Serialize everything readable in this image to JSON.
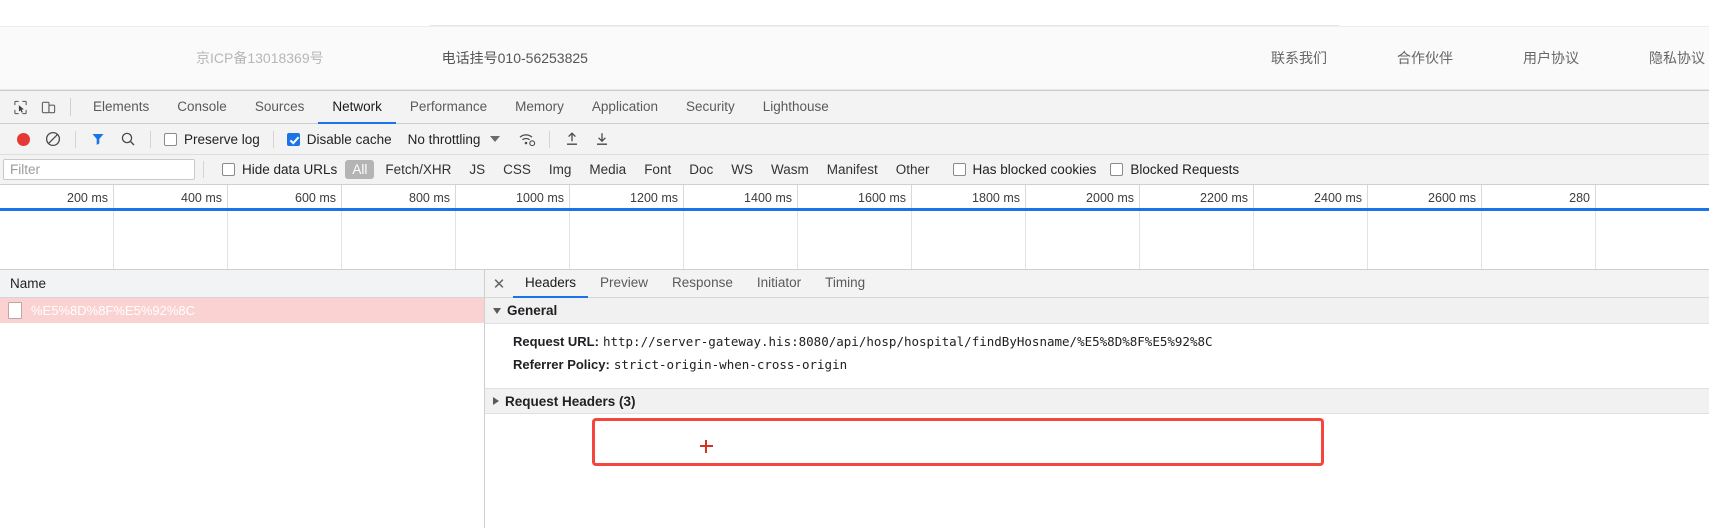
{
  "site": {
    "icp": "京ICP备13018369号",
    "tel": "电话挂号010-56253825",
    "links": [
      "联系我们",
      "合作伙伴",
      "用户协议",
      "隐私协议"
    ]
  },
  "devtools": {
    "inspect_icon": "inspect-element-icon",
    "device_icon": "device-toolbar-icon",
    "tabs": [
      {
        "label": "Elements",
        "active": false
      },
      {
        "label": "Console",
        "active": false
      },
      {
        "label": "Sources",
        "active": false
      },
      {
        "label": "Network",
        "active": true
      },
      {
        "label": "Performance",
        "active": false
      },
      {
        "label": "Memory",
        "active": false
      },
      {
        "label": "Application",
        "active": false
      },
      {
        "label": "Security",
        "active": false
      },
      {
        "label": "Lighthouse",
        "active": false
      }
    ],
    "toolbar": {
      "record_icon": "record-stop-icon",
      "clear_icon": "clear-icon",
      "filter_icon": "filter-funnel-icon",
      "search_icon": "search-icon",
      "preserve_log": {
        "label": "Preserve log",
        "checked": false
      },
      "disable_cache": {
        "label": "Disable cache",
        "checked": true
      },
      "throttling": "No throttling",
      "wifi_icon": "network-conditions-icon",
      "import_icon": "import-har-icon",
      "export_icon": "export-har-icon"
    },
    "filterbar": {
      "filter_placeholder": "Filter",
      "filter_value": "",
      "hide_data_urls": {
        "label": "Hide data URLs",
        "checked": false
      },
      "types": [
        "All",
        "Fetch/XHR",
        "JS",
        "CSS",
        "Img",
        "Media",
        "Font",
        "Doc",
        "WS",
        "Wasm",
        "Manifest",
        "Other"
      ],
      "selected_type": "All",
      "has_blocked_cookies": {
        "label": "Has blocked cookies",
        "checked": false
      },
      "blocked_requests": {
        "label": "Blocked Requests",
        "checked": false
      }
    },
    "timeline": {
      "ticks": [
        "200 ms",
        "400 ms",
        "600 ms",
        "800 ms",
        "1000 ms",
        "1200 ms",
        "1400 ms",
        "1600 ms",
        "1800 ms",
        "2000 ms",
        "2200 ms",
        "2400 ms",
        "2600 ms",
        "280"
      ]
    },
    "requests": {
      "column_header": "Name",
      "rows": [
        {
          "name": "%E5%8D%8F%E5%92%8C",
          "icon": "document-icon",
          "state": "error"
        }
      ]
    },
    "details": {
      "close_icon": "close-icon",
      "tabs": [
        {
          "label": "Headers",
          "active": true
        },
        {
          "label": "Preview",
          "active": false
        },
        {
          "label": "Response",
          "active": false
        },
        {
          "label": "Initiator",
          "active": false
        },
        {
          "label": "Timing",
          "active": false
        }
      ],
      "general": {
        "title": "General",
        "expanded": true,
        "rows": [
          {
            "key": "Request URL:",
            "value": "http://server-gateway.his:8080/api/hosp/hospital/findByHosname/%E5%8D%8F%E5%92%8C"
          },
          {
            "key": "Referrer Policy:",
            "value": "strict-origin-when-cross-origin"
          }
        ]
      },
      "request_headers": {
        "title": "Request Headers (3)",
        "expanded": false
      },
      "highlight_color": "#f4463c"
    }
  }
}
